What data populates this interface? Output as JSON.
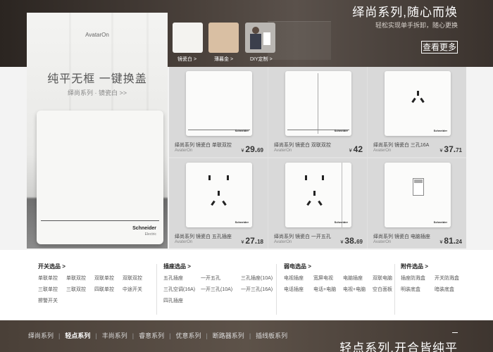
{
  "banner": {
    "title": "绎尚系列,随心而焕",
    "subtitle": "轻松实现单手拆卸，随心更换",
    "more_label": "查看更多",
    "swatches": [
      {
        "label": "镜瓷白",
        "color": "#f4f3f0"
      },
      {
        "label": "薄暮金",
        "color": "#d9bfa3"
      },
      {
        "label": "DIY定制",
        "color": "#b9b6b2"
      }
    ],
    "arrow": ">"
  },
  "hero": {
    "brand": "AvatarOn",
    "title": "纯平无框 一键换盖",
    "subtitle": "绎尚系列 · 镜瓷白 >>",
    "logo": "Schneider",
    "logo_sub": "Electric"
  },
  "products": [
    {
      "name": "绎尚系列 镜瓷白 单联双控",
      "en": "AvaterOn",
      "currency": "¥",
      "int": "29.",
      "dec": "69"
    },
    {
      "name": "绎尚系列 镜瓷白 双联双控",
      "en": "AvaterOn",
      "currency": "¥",
      "int": "42",
      "dec": ""
    },
    {
      "name": "绎尚系列 镜瓷白 三孔16A",
      "en": "AvaterOn",
      "currency": "¥",
      "int": "37.",
      "dec": "71"
    },
    {
      "name": "绎尚系列 镜瓷白 五孔插座",
      "en": "AvaterOn",
      "currency": "¥",
      "int": "27.",
      "dec": "18"
    },
    {
      "name": "绎尚系列 镜瓷白 一开五孔",
      "en": "AvaterOn",
      "currency": "¥",
      "int": "38.",
      "dec": "69"
    },
    {
      "name": "绎尚系列 镜瓷白 电脑插座",
      "en": "AvaterOn",
      "currency": "¥",
      "int": "81.",
      "dec": "24"
    }
  ],
  "plate_logo": "Schneider",
  "categories": [
    {
      "head": "开关选品 >",
      "items": [
        "单联单控",
        "单联双控",
        "双联单控",
        "双联双控",
        "三联单控",
        "三联双控",
        "四联单控",
        "中途开关",
        "擦警开关"
      ]
    },
    {
      "head": "插座选品 >",
      "items": [
        "五孔插座",
        "一开五孔",
        "三孔插座(10A)",
        "三孔空调(16A)",
        "一开三孔(10A)",
        "一开三孔(16A)",
        "四孔插座"
      ]
    },
    {
      "head": "弱电选品 >",
      "items": [
        "电视插座",
        "宽屏电视",
        "电脑插座",
        "双联电脑",
        "电话插座",
        "电话+电脑",
        "电视+电脑",
        "空白面板"
      ]
    },
    {
      "head": "附件选品 >",
      "items": [
        "插座防溅盒",
        "开关防溅盒",
        "明装底盒",
        "暗装底盒"
      ]
    }
  ],
  "nav": {
    "items": [
      "绎尚系列",
      "轻点系列",
      "丰尚系列",
      "睿意系列",
      "优意系列",
      "断路器系列",
      "插线板系列"
    ],
    "active_index": 1,
    "title": "轻点系列,开合皆纯平"
  }
}
